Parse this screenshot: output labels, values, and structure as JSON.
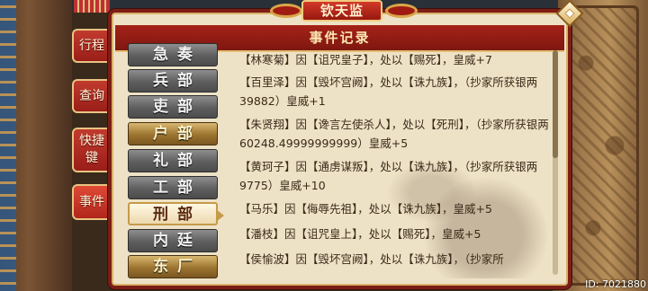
{
  "window_title": "钦天监",
  "panel_header": "事件记录",
  "side_tabs": [
    {
      "label": "行程"
    },
    {
      "label": "查询"
    },
    {
      "label": "快捷\n键"
    },
    {
      "label": "事件"
    }
  ],
  "departments": [
    {
      "label": "急奏",
      "style": "gray"
    },
    {
      "label": "兵部",
      "style": "gray"
    },
    {
      "label": "吏部",
      "style": "gray"
    },
    {
      "label": "户部",
      "style": "gold"
    },
    {
      "label": "礼部",
      "style": "gray"
    },
    {
      "label": "工部",
      "style": "gray"
    },
    {
      "label": "刑部",
      "style": "selected"
    },
    {
      "label": "内廷",
      "style": "gray"
    },
    {
      "label": "东厂",
      "style": "gold"
    }
  ],
  "events": [
    {
      "text": "【林寒菊】因【诅咒皇子】，处以【赐死】，皇威+7"
    },
    {
      "text": "【百里泽】因【毁坏宫阙】，处以【诛九族】，（抄家所获银两39882）皇威+1"
    },
    {
      "text": "【朱贤翔】因【谗言左使杀人】，处以【死刑】，（抄家所获银两60248.49999999999）皇威+5"
    },
    {
      "text": "【黄珂子】因【通虏谋叛】，处以【诛九族】，（抄家所获银两9775）皇威+10"
    },
    {
      "text": "【马乐】因【侮辱先祖】，处以【诛九族】，皇威+5"
    },
    {
      "text": "【潘枝】因【诅咒皇上】，处以【赐死】，皇威+5"
    },
    {
      "text": "【侯愉波】因【毁坏宫阙】，处以【诛九族】，（抄家所"
    }
  ],
  "user_id": "ID: 7021880",
  "colors": {
    "panel_red": "#7c1e16",
    "parchment": "#eee2c6",
    "gold": "#d9b26a"
  }
}
